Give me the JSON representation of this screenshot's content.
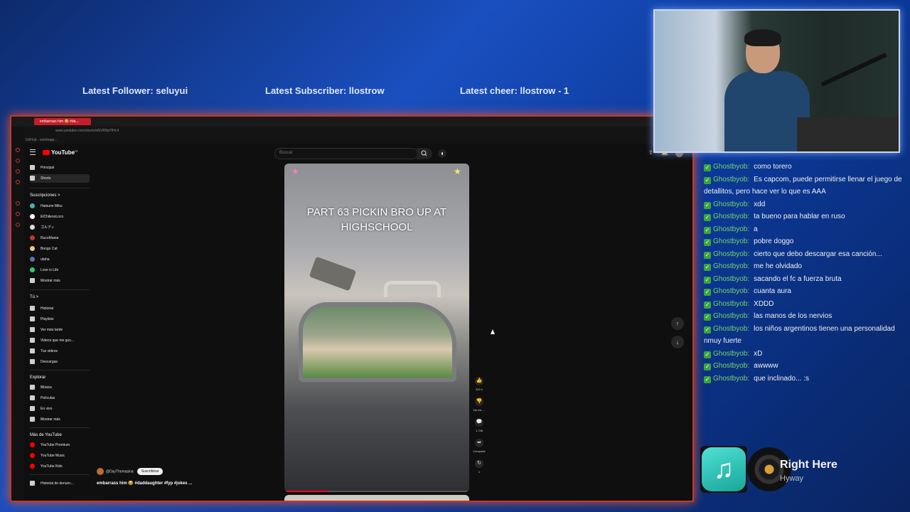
{
  "overlay": {
    "latest_follower": "Latest Follower: seluyui",
    "latest_subscriber": "Latest Subscriber: llostrow",
    "latest_cheer": "Latest cheer: llostrow - 1"
  },
  "browser": {
    "tab_title": "embarrass him 😂 #da...",
    "url": "www.youtube.com/shorts/dSVR9qYlHL4",
    "bookmark": "GitHub - wirebapp..."
  },
  "youtube": {
    "logo": "YouTube",
    "logo_country": "MX",
    "search_placeholder": "Buscar",
    "sidebar": {
      "main": [
        {
          "label": "Principal",
          "icon": "home-icon"
        },
        {
          "label": "Shorts",
          "icon": "shorts-icon"
        }
      ],
      "subscriptions_heading": "Suscripciones  >",
      "subscriptions": [
        {
          "label": "Hatsune Miku",
          "color": "#4ab3a9"
        },
        {
          "label": "ElChilenoLoco",
          "color": "#ffffff"
        },
        {
          "label": "ゴルディ",
          "color": "#dddddd"
        },
        {
          "label": "RucoMania",
          "color": "#c0392b"
        },
        {
          "label": "Bongo Cat",
          "color": "#f3c58a"
        },
        {
          "label": "utaha",
          "color": "#5577aa"
        },
        {
          "label": "Love is Life",
          "color": "#2ecc71"
        },
        {
          "label": "Mostrar más",
          "color": "#555555"
        }
      ],
      "you_heading": "Tú  >",
      "you": [
        {
          "label": "Historial"
        },
        {
          "label": "Playlists"
        },
        {
          "label": "Ver más tarde"
        },
        {
          "label": "Videos que me gus..."
        },
        {
          "label": "Tus videos"
        },
        {
          "label": "Descargas"
        }
      ],
      "explore_heading": "Explorar",
      "explore": [
        {
          "label": "Música"
        },
        {
          "label": "Películas"
        },
        {
          "label": "En vivo"
        },
        {
          "label": "Mostrar más"
        }
      ],
      "more_heading": "Más de YouTube",
      "more": [
        {
          "label": "YouTube Premium"
        },
        {
          "label": "YouTube Music"
        },
        {
          "label": "YouTube Kids"
        }
      ],
      "report": "Historial de denunc..."
    },
    "short": {
      "overlay_title": "PART 63 PICKIN BRO UP AT HIGHSCHOOL",
      "channel": "@DayThomasina",
      "subscribe": "Suscribirse",
      "description": "embarrass him 😂 #daddaughter #fyp #jokes ...",
      "progress": 0.24,
      "actions": {
        "likes": "323 k",
        "dislike": "No me ...",
        "comments": "1,748",
        "share": "Compartir",
        "remix": "1"
      }
    }
  },
  "chat": [
    {
      "user": "Ghostbyob:",
      "text": "como torero"
    },
    {
      "user": "Ghostbyob:",
      "text": "Es capcom, puede permitirse llenar el juego de detallitos, pero hace ver lo que es AAA"
    },
    {
      "user": "Ghostbyob:",
      "text": "xdd"
    },
    {
      "user": "Ghostbyob:",
      "text": "ta bueno para hablar en ruso"
    },
    {
      "user": "Ghostbyob:",
      "text": "a"
    },
    {
      "user": "Ghostbyob:",
      "text": "pobre doggo"
    },
    {
      "user": "Ghostbyob:",
      "text": "cierto que debo descargar esa canción..."
    },
    {
      "user": "Ghostbyob:",
      "text": "me he olvidado"
    },
    {
      "user": "Ghostbyob:",
      "text": "sacando el fc a fuerza bruta"
    },
    {
      "user": "Ghostbyob:",
      "text": "cuanta aura"
    },
    {
      "user": "Ghostbyob:",
      "text": "XDDD"
    },
    {
      "user": "Ghostbyob:",
      "text": "las manos de los nervios"
    },
    {
      "user": "Ghostbyob:",
      "text": "los niños argentinos tienen una personalidad nmuy fuerte"
    },
    {
      "user": "Ghostbyob:",
      "text": "xD"
    },
    {
      "user": "Ghostbyob:",
      "text": "awwww"
    },
    {
      "user": "Ghostbyob:",
      "text": "que inclinado... :s"
    }
  ],
  "now_playing": {
    "song": "Right Here",
    "artist": "Hyway"
  },
  "colors": {
    "accent_red": "#c0392b",
    "chat_user": "#74d36a",
    "yt_red": "#ff0000"
  }
}
